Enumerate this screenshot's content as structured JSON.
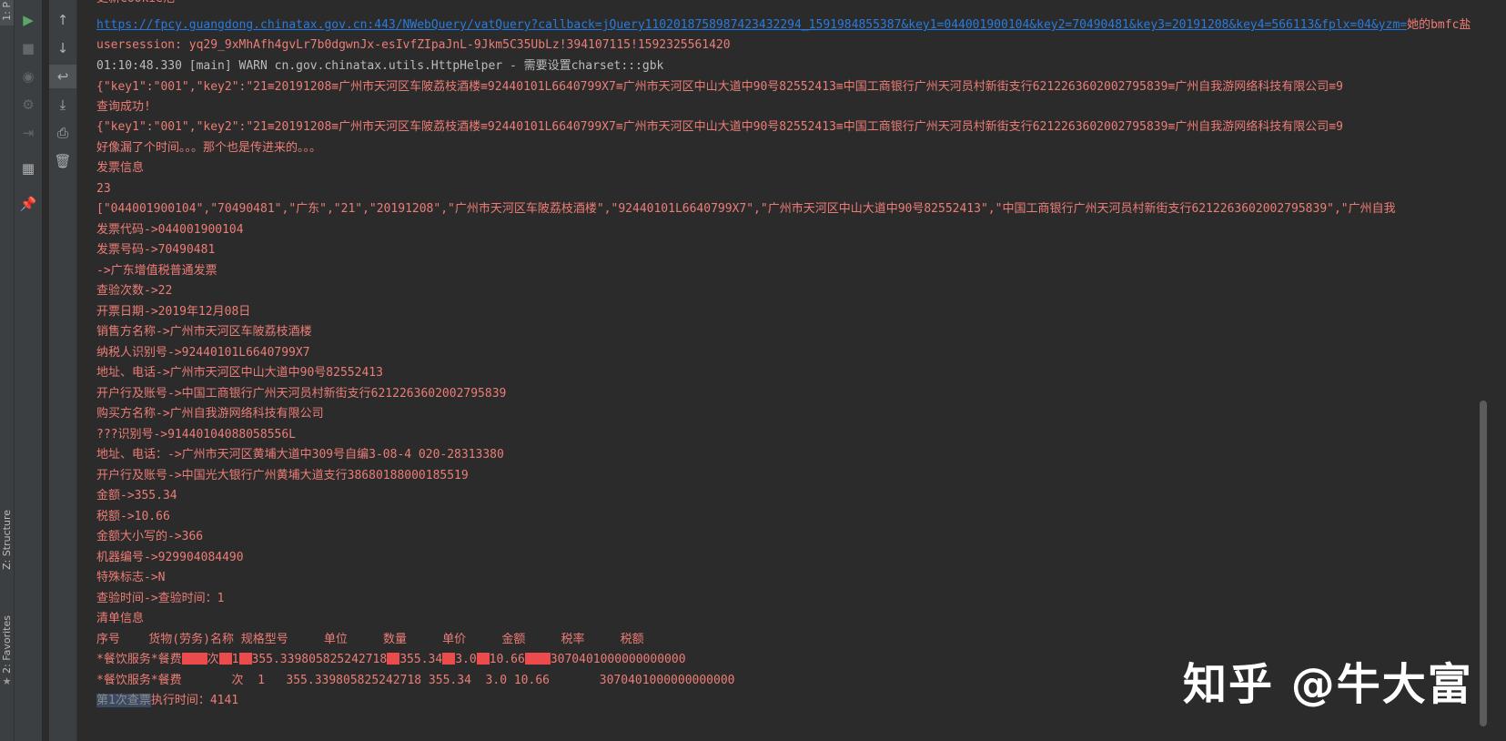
{
  "side_panel": {
    "top_tab": "1: P",
    "structure_label": "Z: Structure",
    "favorites_label": "2: Favorites",
    "favorites_star": "★"
  },
  "toolbar": {
    "run": "▶",
    "stop": "■",
    "camera": "◉",
    "debug": "⚙",
    "exit": "⇥",
    "layout": "▦",
    "pin": "📌",
    "up": "↑",
    "down": "↓",
    "wrap": "↩",
    "scroll_end": "⤓",
    "print": "⎙",
    "trash": "🗑"
  },
  "console": {
    "l0": "更新Cookie池",
    "l1": "https://fpcy.guangdong.chinatax.gov.cn:443/NWebQuery/vatQuery?callback=jQuery110201875898742343229​4_1591984855387&key1=044001900104&key2=70490481&key3=20191208&key4=566113&fplx=04&yzm=",
    "l1_tail": "她的bmfc盐",
    "l2": "usersession:        yq29_9xMhAfh4gvLr7b0dgwnJx-esIvfZIpaJnL-9Jkm5C35UbLz!394107115!1592325561420",
    "l3": "01:10:48.330 [main] WARN cn.gov.chinatax.utils.HttpHelper - 需要设置charset:::gbk",
    "l4": "{\"key1\":\"001\",\"key2\":\"21≡20191208≡广州市天河区车陂荔枝酒楼≡92440101L6640799X7≡广州市天河区中山大道中90号82552413≡中国工商银行广州天河员村新街支行6212263602002795839≡广州自我游网络科技有限公司≡9",
    "l5": "查询成功!",
    "l6": "{\"key1\":\"001\",\"key2\":\"21≡20191208≡广州市天河区车陂荔枝酒楼≡92440101L6640799X7≡广州市天河区中山大道中90号82552413≡中国工商银行广州天河员村新街支行6212263602002795839≡广州自我游网络科技有限公司≡9",
    "l7": "好像漏了个时间。。。那个也是传进来的。。。",
    "l8": "发票信息",
    "l9": "23",
    "l10": "[\"044001900104\",\"70490481\",\"广东\",\"21\",\"20191208\",\"广州市天河区车陂荔枝酒楼\",\"92440101L6640799X7\",\"广州市天河区中山大道中90号82552413\",\"中国工商银行广州天河员村新街支行6212263602002795839\",\"广州自我",
    "l11": "发票代码->044001900104",
    "l12": "发票号码->70490481",
    "l13": "->广东增值税普通发票",
    "l14": "查验次数->22",
    "l15": "开票日期->2019年12月08日",
    "l16": "销售方名称->广州市天河区车陂荔枝酒楼",
    "l17": "纳税人识别号->92440101L6640799X7",
    "l18": "地址、电话->广州市天河区中山大道中90号82552413",
    "l19": "开户行及账号->中国工商银行广州天河员村新街支行6212263602002795839",
    "l20": "购买方名称->广州自我游网络科技有限公司",
    "l21": "???识别号->91440104088058556L",
    "l22": "地址、电话：->广州市天河区黄埔大道中309号自编3-08-4 020-28313380",
    "l23": "开户行及账号->中国光大银行广州黄埔大道支行38680188000185519",
    "l24": "金额->355.34",
    "l25": "税额->10.66",
    "l26": "金额大小写的->366",
    "l27": "机器编号->929904084490",
    "l28": "特殊标志->N",
    "l29": "查验时间->查验时间：1",
    "l30": "清单信息",
    "l31": "序号    货物(劳务)名称 规格型号     单位     数量     单价     金额     税率     税额",
    "l32a": "*餐饮服务*餐费",
    "l32b": "次",
    "l32c": "1",
    "l32d": "355.339805825242718",
    "l32e": "355.34",
    "l32f": "3.0",
    "l32g": "10.66",
    "l32h": "3070401000000000000",
    "l33": "*餐饮服务*餐费       次  1   355.339805825242718 355.34  3.0 10.66       3070401000000000000",
    "l34a": "第1次查票",
    "l34b": "执行时间：4141"
  },
  "watermark": "知乎 @牛大富"
}
